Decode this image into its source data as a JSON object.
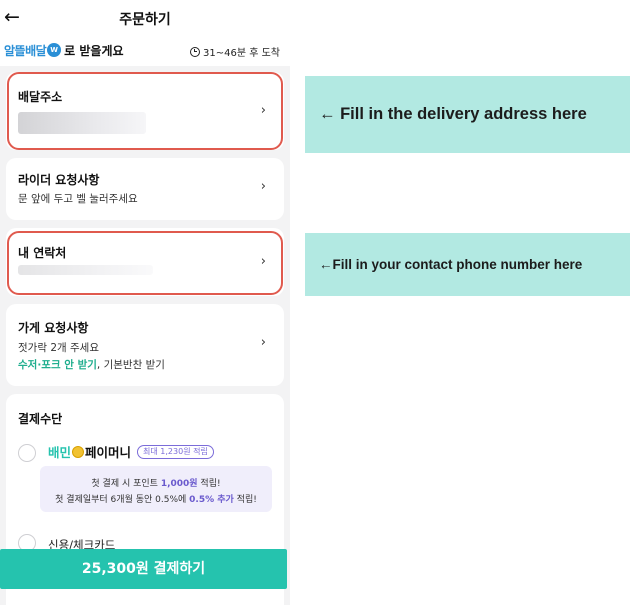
{
  "colors": {
    "accent": "#25c3ae",
    "highlight": "#e05a4e",
    "callout_bg": "#b2e9e2",
    "brand": "#2a8fd6",
    "promo": "#6a5acd"
  },
  "header": {
    "back_icon": "←",
    "title": "주문하기"
  },
  "delivery": {
    "brand": "알뜰배달",
    "brand_badge": "W",
    "suffix": "로 받을게요",
    "eta": "31~46분 후 도착"
  },
  "address_card": {
    "label": "배달주소"
  },
  "rider_card": {
    "label": "라이더 요청사항",
    "value": "문 앞에 두고 벨 눌러주세요"
  },
  "contact_card": {
    "label": "내 연락처"
  },
  "store_card": {
    "label": "가게 요청사항",
    "value": "젓가락 2개 주세요",
    "option_green": "수저·포크 안 받기",
    "option_rest": ", 기본반찬 받기"
  },
  "payment": {
    "label": "결제수단",
    "brand_a": "배민",
    "brand_b": "페이머니",
    "tag": "최대 1,230원 적립",
    "promo_line1_a": "첫 결제 시 포인트 ",
    "promo_line1_b": "1,000원",
    "promo_line1_c": " 적립!",
    "promo_line2_a": "첫 결제일부터 6개월 동안 0.5%에 ",
    "promo_line2_b": "0.5% 추가",
    "promo_line2_c": " 적립!",
    "card_option": "신용/체크카드"
  },
  "pay_button": "25,300원 결제하기",
  "callouts": {
    "address": "← Fill in the delivery address here",
    "phone": "←Fill in your contact phone number here"
  }
}
